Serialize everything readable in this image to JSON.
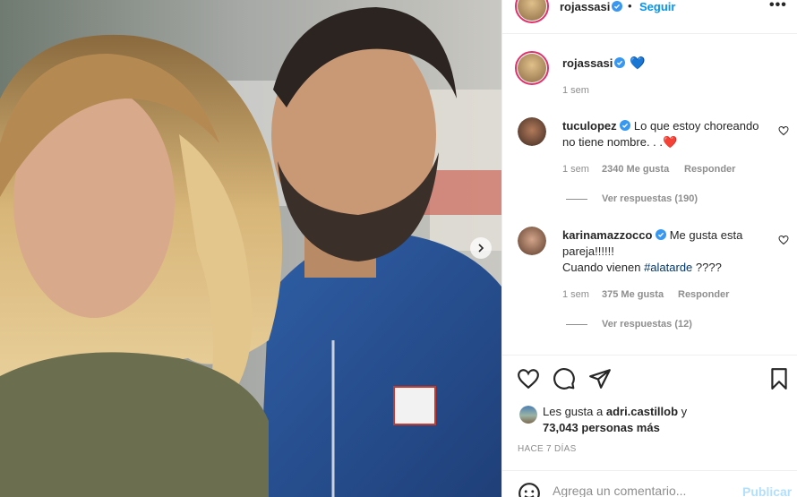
{
  "post": {
    "author": "rojassasi",
    "follow_label": "Seguir",
    "separator": "•",
    "more_label": "•••",
    "caption_emoji": "💙",
    "caption_time": "1 sem"
  },
  "comments": [
    {
      "user": "tuculopez",
      "text": "Lo que estoy choreando no tiene nombre. . .",
      "emoji": "❤️",
      "time": "1 sem",
      "likes": "2340 Me gusta",
      "reply": "Responder",
      "view_replies": "Ver respuestas (190)"
    },
    {
      "user": "karinamazzocco",
      "text_before": "Me gusta esta pareja!!!!!!",
      "text_line2_before": "Cuando vienen ",
      "hashtag": "#alatarde",
      "text_after": " ????",
      "time": "1 sem",
      "likes": "375 Me gusta",
      "reply": "Responder",
      "view_replies": "Ver respuestas (12)"
    }
  ],
  "likes": {
    "prefix": "Les gusta a",
    "first_user": "adri.castillob",
    "conj": "y",
    "others": "73,043 personas más"
  },
  "time_ago": "HACE 7 DÍAS",
  "comment_box": {
    "placeholder": "Agrega un comentario...",
    "publish_label": "Publicar"
  },
  "icons": {
    "verified": "verified-badge-icon",
    "like": "heart-icon",
    "comment": "comment-bubble-icon",
    "share": "paper-plane-icon",
    "save": "bookmark-icon",
    "emoji": "smiley-icon",
    "next": "chevron-right-icon"
  },
  "colors": {
    "accent": "#0095f6",
    "verified": "#3897f0",
    "hashtag": "#00376b",
    "muted": "#8e8e8e",
    "publish_disabled": "#b2dffc"
  }
}
